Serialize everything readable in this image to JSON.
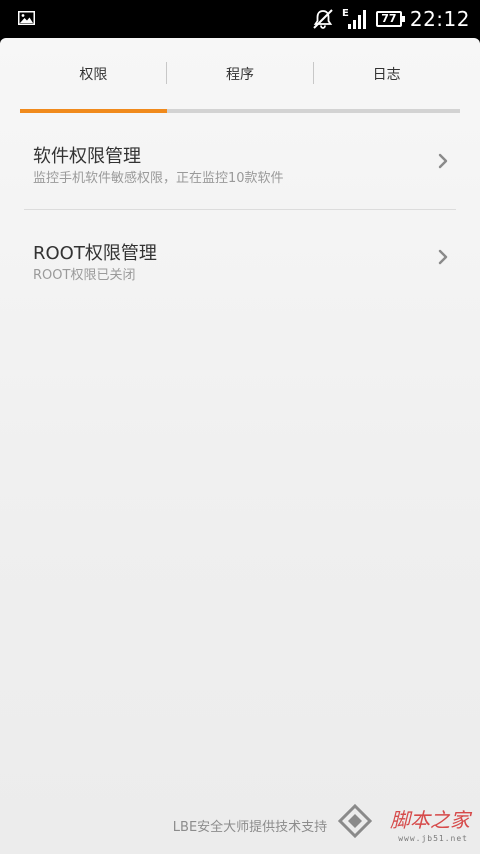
{
  "status_bar": {
    "time": "22:12",
    "network_type": "E",
    "battery_level": "77",
    "icons": [
      "gallery-icon",
      "notification-muted-icon",
      "signal-icon",
      "battery-icon"
    ]
  },
  "tabs": {
    "items": [
      {
        "label": "权限",
        "active": true
      },
      {
        "label": "程序",
        "active": false
      },
      {
        "label": "日志",
        "active": false
      }
    ],
    "accent_color": "#f08a1c"
  },
  "list": {
    "items": [
      {
        "title": "软件权限管理",
        "subtitle": "监控手机软件敏感权限，正在监控10款软件"
      },
      {
        "title": "ROOT权限管理",
        "subtitle": "ROOT权限已关闭"
      }
    ]
  },
  "footer": {
    "support_text": "LBE安全大师提供技术支持",
    "watermark": "脚本之家",
    "watermark_url": "www.jb51.net"
  }
}
